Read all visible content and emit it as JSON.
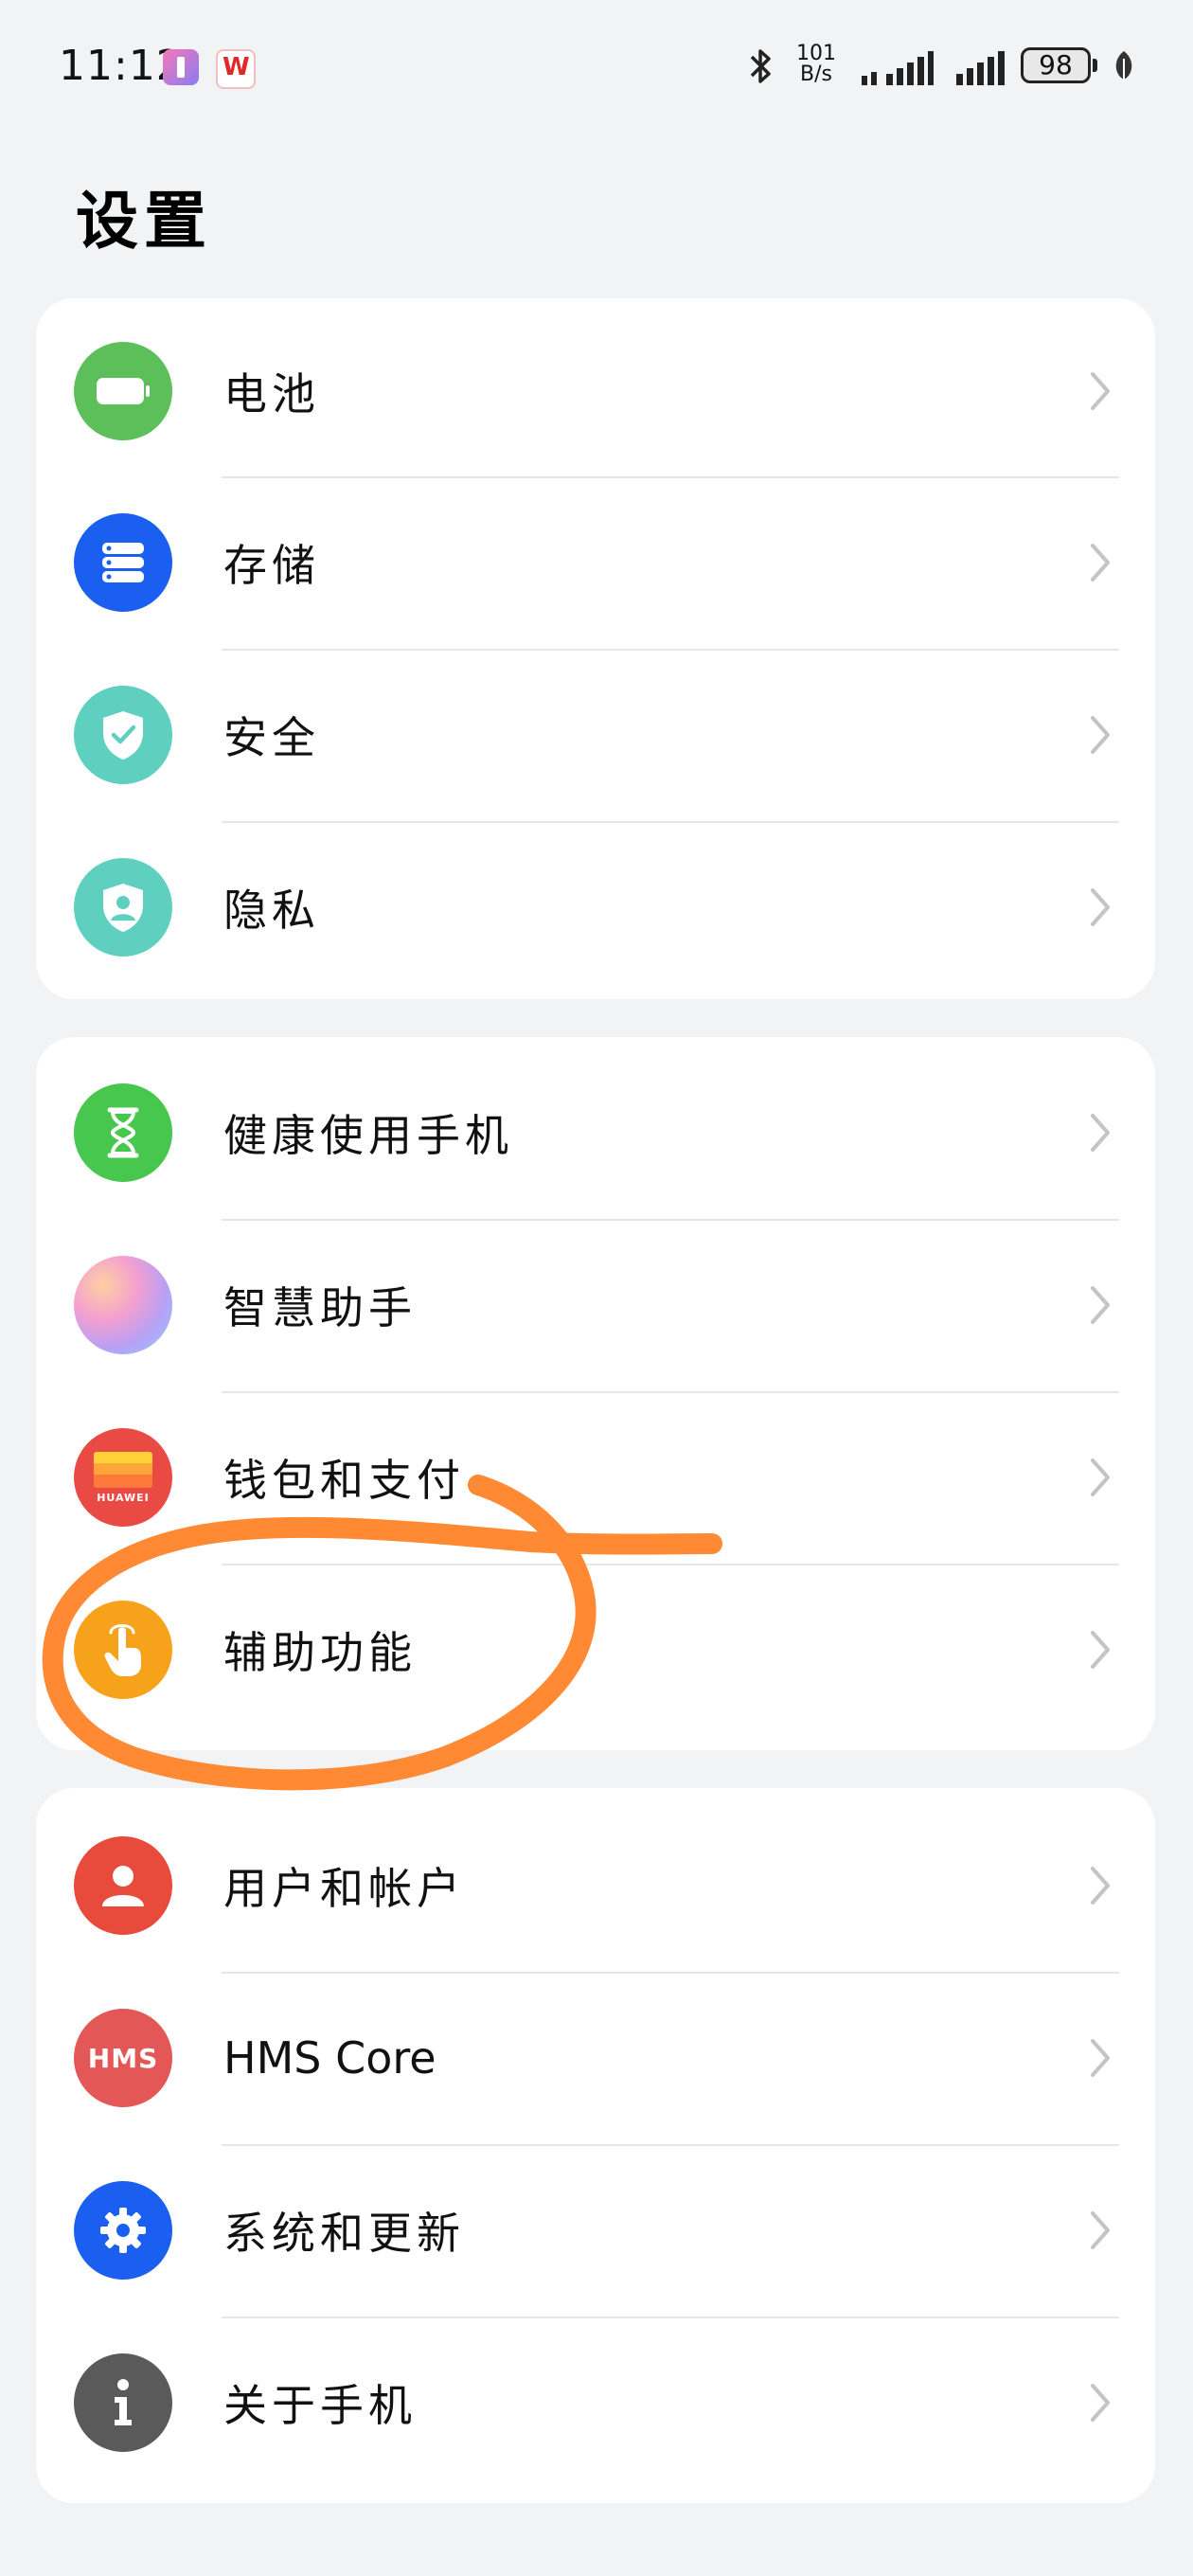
{
  "status_bar": {
    "time": "11:12",
    "net_speed_value": "101",
    "net_speed_unit": "B/s",
    "battery_level": "98",
    "icons": [
      "app-notification-icon",
      "wps-icon",
      "bluetooth-icon",
      "signal-icon",
      "signal-icon",
      "battery-icon",
      "eco-leaf-icon"
    ]
  },
  "page_title": "设置",
  "groups": [
    {
      "items": [
        {
          "label": "电池",
          "icon": "battery-icon",
          "color": "#5cbf5a"
        },
        {
          "label": "存储",
          "icon": "storage-icon",
          "color": "#1a5ff0"
        },
        {
          "label": "安全",
          "icon": "security-shield-icon",
          "color": "#5fd0bf"
        },
        {
          "label": "隐私",
          "icon": "privacy-shield-icon",
          "color": "#5fd0bf"
        }
      ]
    },
    {
      "items": [
        {
          "label": "健康使用手机",
          "icon": "hourglass-icon",
          "color": "#47c74d"
        },
        {
          "label": "智慧助手",
          "icon": "smart-assistant-icon",
          "color": "#c8a6f5"
        },
        {
          "label": "钱包和支付",
          "icon": "huawei-wallet-icon",
          "color": "#ea4a44"
        },
        {
          "label": "辅助功能",
          "icon": "accessibility-hand-icon",
          "color": "#f7a21b"
        }
      ]
    },
    {
      "items": [
        {
          "label": "用户和帐户",
          "icon": "user-icon",
          "color": "#e84a3b"
        },
        {
          "label": "HMS Core",
          "icon": "hms-icon",
          "color": "#e45757"
        },
        {
          "label": "系统和更新",
          "icon": "gear-icon",
          "color": "#1a5ff0"
        },
        {
          "label": "关于手机",
          "icon": "info-icon",
          "color": "#5a5a5a"
        }
      ]
    }
  ],
  "wallet_badge_text": "HUAWEI",
  "hms_badge_text": "HMS",
  "annotation_color": "#ff8a33"
}
